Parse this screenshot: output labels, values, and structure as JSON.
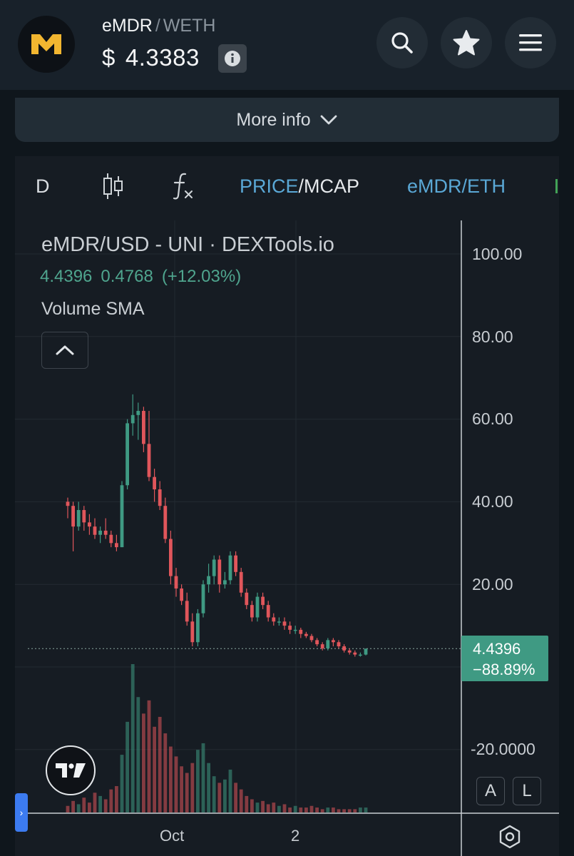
{
  "header": {
    "base_symbol": "eMDR",
    "separator": "/",
    "quote_symbol": "WETH",
    "currency": "$",
    "price": "4.3383"
  },
  "more_info": {
    "label": "More info"
  },
  "toolbar": {
    "interval": "D",
    "price_label": "PRICE",
    "slash": "/",
    "mcap_label": "MCAP",
    "pair_toggle": "eMDR/ETH"
  },
  "legend": {
    "title": "eMDR/USD - UNI · DEXTools.io",
    "last": "4.4396",
    "change": "0.4768",
    "change_pct": "(+12.03%)",
    "volume": "Volume SMA"
  },
  "price_tag": {
    "value": "4.4396",
    "pct": "−88.89%"
  },
  "colors": {
    "up": "#3f9a83",
    "down": "#e0565b",
    "bg": "#161c23",
    "grid": "#232a32"
  },
  "buttons": {
    "auto": "A",
    "log": "L"
  },
  "chart_data": {
    "type": "bar",
    "title": "eMDR/USD - UNI · DEXTools.io",
    "y_ticks": [
      "100.00",
      "80.00",
      "60.00",
      "40.00",
      "20.00",
      "-20.0000"
    ],
    "x_ticks": [
      "Oct",
      "2"
    ],
    "ylim": [
      -35,
      110
    ],
    "last_price": 4.4396,
    "candles": [
      {
        "o": 40,
        "h": 41,
        "l": 36,
        "c": 39
      },
      {
        "o": 39,
        "h": 40,
        "l": 28,
        "c": 34
      },
      {
        "o": 34,
        "h": 40,
        "l": 33,
        "c": 38
      },
      {
        "o": 38,
        "h": 39,
        "l": 33,
        "c": 35
      },
      {
        "o": 35,
        "h": 37,
        "l": 32,
        "c": 34
      },
      {
        "o": 34,
        "h": 36,
        "l": 31,
        "c": 32
      },
      {
        "o": 32,
        "h": 34,
        "l": 30,
        "c": 33
      },
      {
        "o": 33,
        "h": 36,
        "l": 31,
        "c": 32
      },
      {
        "o": 32,
        "h": 33,
        "l": 29,
        "c": 30
      },
      {
        "o": 30,
        "h": 32,
        "l": 28,
        "c": 29
      },
      {
        "o": 29,
        "h": 45,
        "l": 29,
        "c": 44
      },
      {
        "o": 44,
        "h": 60,
        "l": 43,
        "c": 59
      },
      {
        "o": 59,
        "h": 66,
        "l": 56,
        "c": 61
      },
      {
        "o": 61,
        "h": 64,
        "l": 55,
        "c": 62
      },
      {
        "o": 62,
        "h": 63,
        "l": 52,
        "c": 54
      },
      {
        "o": 54,
        "h": 62,
        "l": 45,
        "c": 46
      },
      {
        "o": 46,
        "h": 48,
        "l": 40,
        "c": 43
      },
      {
        "o": 43,
        "h": 45,
        "l": 38,
        "c": 39
      },
      {
        "o": 39,
        "h": 41,
        "l": 30,
        "c": 31
      },
      {
        "o": 31,
        "h": 33,
        "l": 20,
        "c": 22
      },
      {
        "o": 22,
        "h": 24,
        "l": 17,
        "c": 19
      },
      {
        "o": 19,
        "h": 20,
        "l": 15,
        "c": 16
      },
      {
        "o": 16,
        "h": 18,
        "l": 10,
        "c": 11
      },
      {
        "o": 11,
        "h": 13,
        "l": 5,
        "c": 6
      },
      {
        "o": 6,
        "h": 14,
        "l": 5,
        "c": 13
      },
      {
        "o": 13,
        "h": 21,
        "l": 12,
        "c": 20
      },
      {
        "o": 20,
        "h": 25,
        "l": 18,
        "c": 22
      },
      {
        "o": 22,
        "h": 27,
        "l": 20,
        "c": 26
      },
      {
        "o": 26,
        "h": 27,
        "l": 18,
        "c": 20
      },
      {
        "o": 20,
        "h": 23,
        "l": 19,
        "c": 21
      },
      {
        "o": 21,
        "h": 28,
        "l": 20,
        "c": 27
      },
      {
        "o": 27,
        "h": 28,
        "l": 22,
        "c": 23
      },
      {
        "o": 23,
        "h": 24,
        "l": 17,
        "c": 18
      },
      {
        "o": 18,
        "h": 19,
        "l": 14,
        "c": 15
      },
      {
        "o": 15,
        "h": 16,
        "l": 11,
        "c": 12
      },
      {
        "o": 12,
        "h": 18,
        "l": 11,
        "c": 17
      },
      {
        "o": 17,
        "h": 18,
        "l": 14,
        "c": 15
      },
      {
        "o": 15,
        "h": 16,
        "l": 11,
        "c": 12
      },
      {
        "o": 12,
        "h": 13,
        "l": 10,
        "c": 11
      },
      {
        "o": 11,
        "h": 12,
        "l": 10,
        "c": 11
      },
      {
        "o": 11,
        "h": 12,
        "l": 9,
        "c": 10
      },
      {
        "o": 10,
        "h": 11,
        "l": 8,
        "c": 9
      },
      {
        "o": 9,
        "h": 10,
        "l": 8,
        "c": 9
      },
      {
        "o": 9,
        "h": 9.5,
        "l": 7,
        "c": 8
      },
      {
        "o": 8,
        "h": 8.5,
        "l": 7,
        "c": 7.5
      },
      {
        "o": 7.5,
        "h": 8,
        "l": 6,
        "c": 6.5
      },
      {
        "o": 6.5,
        "h": 7,
        "l": 5,
        "c": 5.5
      },
      {
        "o": 5.5,
        "h": 6,
        "l": 4,
        "c": 4.5
      },
      {
        "o": 4.5,
        "h": 7,
        "l": 4,
        "c": 6.5
      },
      {
        "o": 6.5,
        "h": 7,
        "l": 5,
        "c": 6
      },
      {
        "o": 6,
        "h": 6.5,
        "l": 4.5,
        "c": 5
      },
      {
        "o": 5,
        "h": 5.5,
        "l": 3.5,
        "c": 4
      },
      {
        "o": 4,
        "h": 4.5,
        "l": 3,
        "c": 3.5
      },
      {
        "o": 3.5,
        "h": 4,
        "l": 2.5,
        "c": 3
      },
      {
        "o": 3,
        "h": 3.5,
        "l": 2.5,
        "c": 3
      },
      {
        "o": 3,
        "h": 4.5,
        "l": 2.8,
        "c": 4.4
      }
    ],
    "volume": [
      4,
      7,
      5,
      9,
      6,
      12,
      10,
      8,
      14,
      16,
      35,
      55,
      90,
      70,
      60,
      68,
      52,
      58,
      48,
      40,
      34,
      28,
      24,
      30,
      38,
      42,
      30,
      22,
      18,
      20,
      26,
      18,
      14,
      10,
      8,
      6,
      7,
      5,
      6,
      4,
      5,
      3,
      4,
      3,
      3,
      4,
      3,
      2,
      3,
      3,
      2,
      2,
      2,
      2,
      3,
      3
    ]
  }
}
